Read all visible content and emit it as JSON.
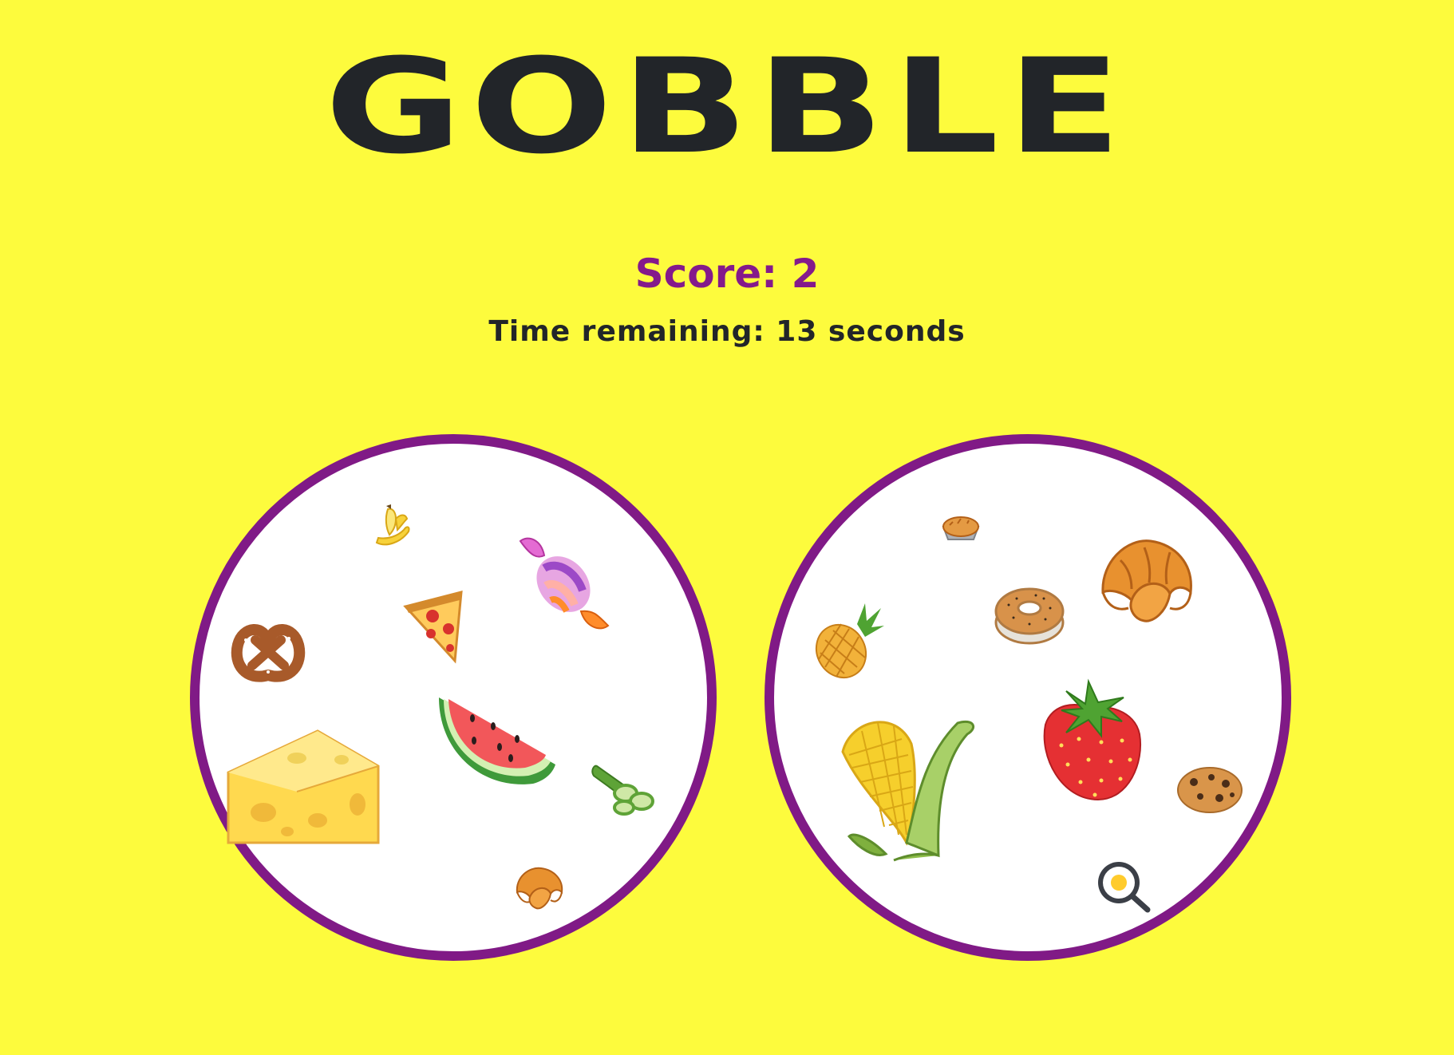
{
  "game": {
    "title": "GOBBLE",
    "score_text": "Score: 2",
    "timer_text": "Time remaining: 13 seconds"
  },
  "cards": {
    "left": [
      "banana",
      "candy",
      "pretzel",
      "pizza",
      "cheese",
      "watermelon",
      "cucumber",
      "croissant"
    ],
    "right": [
      "pie",
      "croissant",
      "bagel",
      "pineapple",
      "corn",
      "strawberry",
      "cookie",
      "fried-egg"
    ]
  },
  "colors": {
    "background": "#fdfb3d",
    "title": "#222529",
    "score": "#841a8b",
    "card_border": "#801a86"
  }
}
